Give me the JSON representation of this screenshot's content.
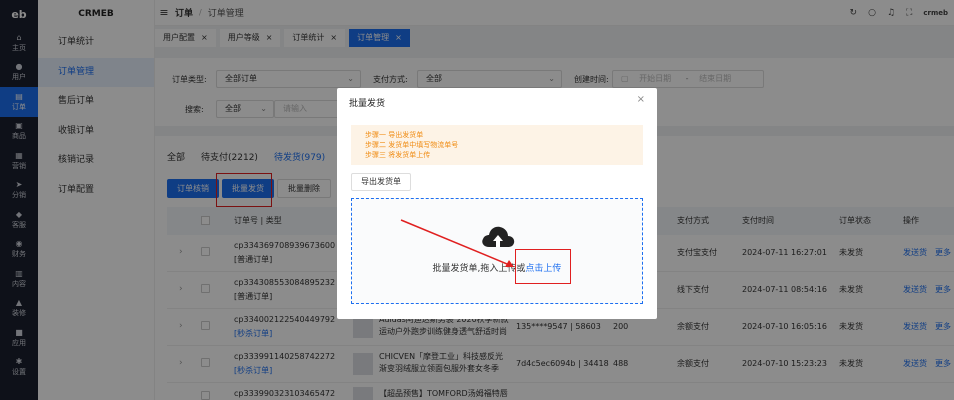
{
  "rail": {
    "logo": "eb",
    "items": [
      {
        "icon": "home-icon",
        "glyph": "⌂",
        "label": "主页"
      },
      {
        "icon": "user-icon",
        "glyph": "●",
        "label": "用户"
      },
      {
        "icon": "order-icon",
        "glyph": "▤",
        "label": "订单"
      },
      {
        "icon": "product-icon",
        "glyph": "▣",
        "label": "商品"
      },
      {
        "icon": "marketing-icon",
        "glyph": "▦",
        "label": "营销"
      },
      {
        "icon": "distribution-icon",
        "glyph": "➤",
        "label": "分销"
      },
      {
        "icon": "service-icon",
        "glyph": "◆",
        "label": "客服"
      },
      {
        "icon": "finance-icon",
        "glyph": "◉",
        "label": "财务"
      },
      {
        "icon": "content-icon",
        "glyph": "▥",
        "label": "内容"
      },
      {
        "icon": "decorate-icon",
        "glyph": "▲",
        "label": "装修"
      },
      {
        "icon": "app-icon",
        "glyph": "■",
        "label": "应用"
      },
      {
        "icon": "settings-icon",
        "glyph": "✱",
        "label": "设置"
      }
    ]
  },
  "sidebar": {
    "brand": "CRMEB",
    "items": [
      {
        "label": "订单统计"
      },
      {
        "label": "订单管理"
      },
      {
        "label": "售后订单"
      },
      {
        "label": "收银订单"
      },
      {
        "label": "核销记录"
      },
      {
        "label": "订单配置"
      }
    ]
  },
  "header": {
    "menu_glyph": "≡",
    "crumb1": "订单",
    "sep": "/",
    "crumb2": "订单管理",
    "user": "crmeb",
    "icons": [
      "refresh-icon",
      "search-icon",
      "bell-icon",
      "fullscreen-icon"
    ]
  },
  "tabs": [
    {
      "label": "用户配置",
      "close": "×"
    },
    {
      "label": "用户等级",
      "close": "×"
    },
    {
      "label": "订单统计",
      "close": "×"
    },
    {
      "label": "订单管理",
      "close": "×"
    }
  ],
  "filter": {
    "type_label": "订单类型:",
    "type_value": "全部订单",
    "pay_label": "支付方式:",
    "pay_value": "全部",
    "time_label": "创建时间:",
    "start_placeholder": "开始日期",
    "dash": "-",
    "end_placeholder": "结束日期",
    "search_label": "搜索:",
    "search_scope": "全部",
    "search_placeholder": "请输入"
  },
  "order_tabs": [
    "全部",
    "待支付(2212)",
    "待发货(979)"
  ],
  "buttons": {
    "verify": "订单核销",
    "batch_ship": "批量发货",
    "batch_delete": "批量删除"
  },
  "table": {
    "headers": {
      "order": "订单号 | 类型",
      "pay_method": "支付方式",
      "pay_time": "支付时间",
      "status": "订单状态",
      "action": "操作"
    },
    "rows": [
      {
        "order_no": "cp334369708939673600",
        "type": "[普通订单]",
        "product": "",
        "user": "",
        "amount": "",
        "pay_method": "支付宝支付",
        "pay_time": "2024-07-11 16:27:01",
        "status": "未发货",
        "ship": "发送货",
        "more": "更多"
      },
      {
        "order_no": "cp334308553084895232",
        "type": "[普通订单]",
        "product": "",
        "user": "",
        "amount": "",
        "pay_method": "线下支付",
        "pay_time": "2024-07-11 08:54:16",
        "status": "未发货",
        "ship": "发送货",
        "more": "更多"
      },
      {
        "order_no": "cp334002122540449792",
        "type": "[秒杀订单]",
        "product": "Adidas阿迪达斯男装 2020秋季新款运动户外跑步训练健身透气舒适时尚",
        "user": "135****9547 | 58603",
        "amount": "200",
        "pay_method": "余额支付",
        "pay_time": "2024-07-10 16:05:16",
        "status": "未发货",
        "ship": "发送货",
        "more": "更多"
      },
      {
        "order_no": "cp333991140258742272",
        "type": "[秒杀订单]",
        "product": "CHICVEN「摩登工业」科技感反光渐变羽绒服立领面包服外套女冬季",
        "user": "7d4c5ec6094b | 34418",
        "amount": "488",
        "pay_method": "余额支付",
        "pay_time": "2024-07-10 15:23:23",
        "status": "未发货",
        "ship": "发送货",
        "more": "更多"
      },
      {
        "order_no": "cp333990323103465472",
        "type": "",
        "product": "【超品预售】TOMFORD汤姆福特唇膏4",
        "user": "",
        "amount": "",
        "pay_method": "",
        "pay_time": "",
        "status": "",
        "ship": "",
        "more": ""
      }
    ]
  },
  "modal": {
    "title": "批量发货",
    "close": "×",
    "steps": [
      "步骤一 导出发货单",
      "步骤二 发货单中填写物流单号",
      "步骤三 将发货单上传"
    ],
    "export_button": "导出发货单",
    "upload_text": "批量发货单,拖入上传或",
    "upload_click": "点击上传"
  },
  "colors": {
    "primary": "#1d6ff0",
    "rail_bg": "#1a1f2e",
    "warning": "#f08c14",
    "highlight": "#e02020"
  }
}
